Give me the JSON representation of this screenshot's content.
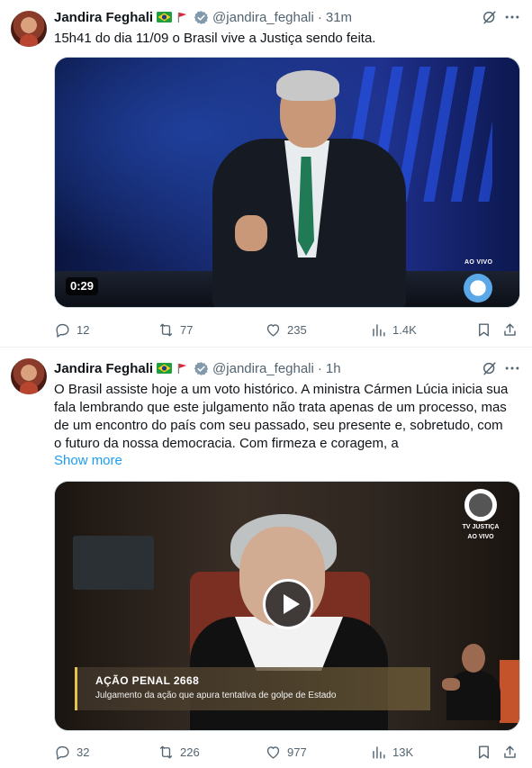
{
  "tweets": [
    {
      "author_name": "Jandira Feghali",
      "handle": "@jandira_feghali",
      "separator": "·",
      "time": "31m",
      "text": "15h41 do dia 11/09 o Brasil vive a Justiça sendo feita.",
      "video": {
        "duration": "0:29",
        "live_badge": "AO VIVO"
      },
      "stats": {
        "replies": "12",
        "reposts": "77",
        "likes": "235",
        "views": "1.4K"
      }
    },
    {
      "author_name": "Jandira Feghali",
      "handle": "@jandira_feghali",
      "separator": "·",
      "time": "1h",
      "text_lines": [
        "O Brasil assiste hoje a um voto histórico. A ministra Cármen Lúcia inicia sua",
        "fala lembrando que este julgamento não trata apenas de um processo, mas",
        "de um encontro do país com seu passado, seu presente e, sobretudo, com",
        "o futuro da nossa democracia. Com firmeza e coragem, a"
      ],
      "show_more": "Show more",
      "video": {
        "channel_line1": "TV JUSTIÇA",
        "channel_line2": "AO VIVO",
        "lower_third_title": "AÇÃO PENAL 2668",
        "lower_third_subtitle": "Julgamento da ação que apura tentativa de golpe de Estado"
      },
      "stats": {
        "replies": "32",
        "reposts": "226",
        "likes": "977",
        "views": "13K"
      }
    }
  ],
  "icons": {
    "flag_brazil": "brazil-flag-icon",
    "flag_red": "red-flag-icon",
    "verified": "verified-badge-icon",
    "grok": "grok-icon",
    "more": "more-icon",
    "reply": "reply-icon",
    "repost": "repost-icon",
    "like": "like-icon",
    "views": "views-icon",
    "bookmark": "bookmark-icon",
    "share": "share-icon"
  },
  "colors": {
    "text": "#0f1419",
    "secondary": "#536471",
    "link": "#1d9bf0",
    "divider": "#eff3f4",
    "verified": "#829aab"
  }
}
